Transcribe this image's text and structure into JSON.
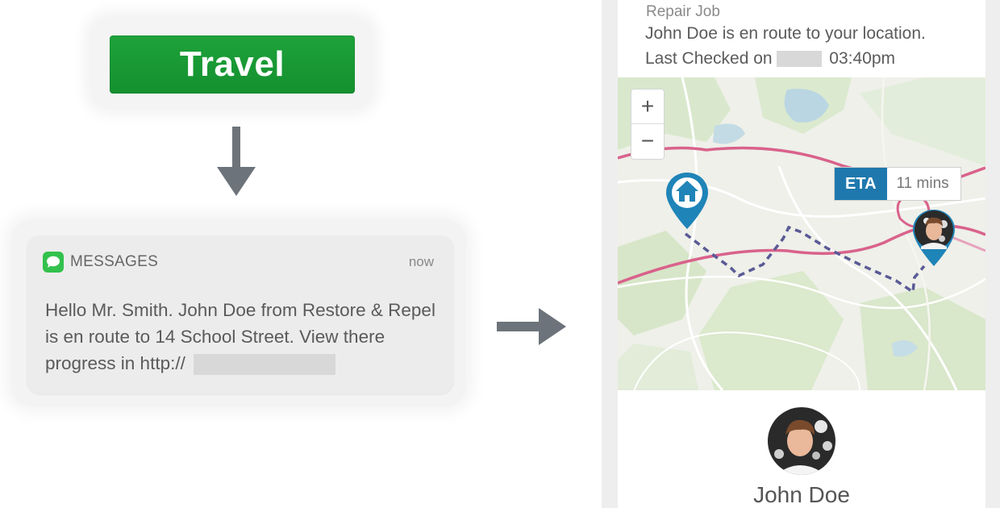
{
  "travel_sign": {
    "label": "Travel"
  },
  "notification": {
    "app_name": "MESSAGES",
    "time": "now",
    "body_text": "Hello Mr. Smith. John Doe from Restore & Repel is en route to 14 School Street. View there progress in http://",
    "app_icon": "message-bubble-icon"
  },
  "tracker": {
    "job_label": "Repair Job",
    "status_text": "John Doe is en route to your location.",
    "last_checked_label": "Last Checked on",
    "last_checked_time": "03:40pm",
    "map": {
      "zoom_in_label": "+",
      "zoom_out_label": "−",
      "eta_label": "ETA",
      "eta_value": "11 mins",
      "home_icon": "home-pin-icon",
      "driver_icon": "driver-avatar-pin-icon"
    },
    "driver_name": "John Doe"
  },
  "colors": {
    "travel_green": "#1a9a35",
    "eta_blue": "#1f78ad",
    "messages_green": "#33c14d",
    "route_pink": "#d9628c",
    "route_dashed": "#5a5a96"
  }
}
